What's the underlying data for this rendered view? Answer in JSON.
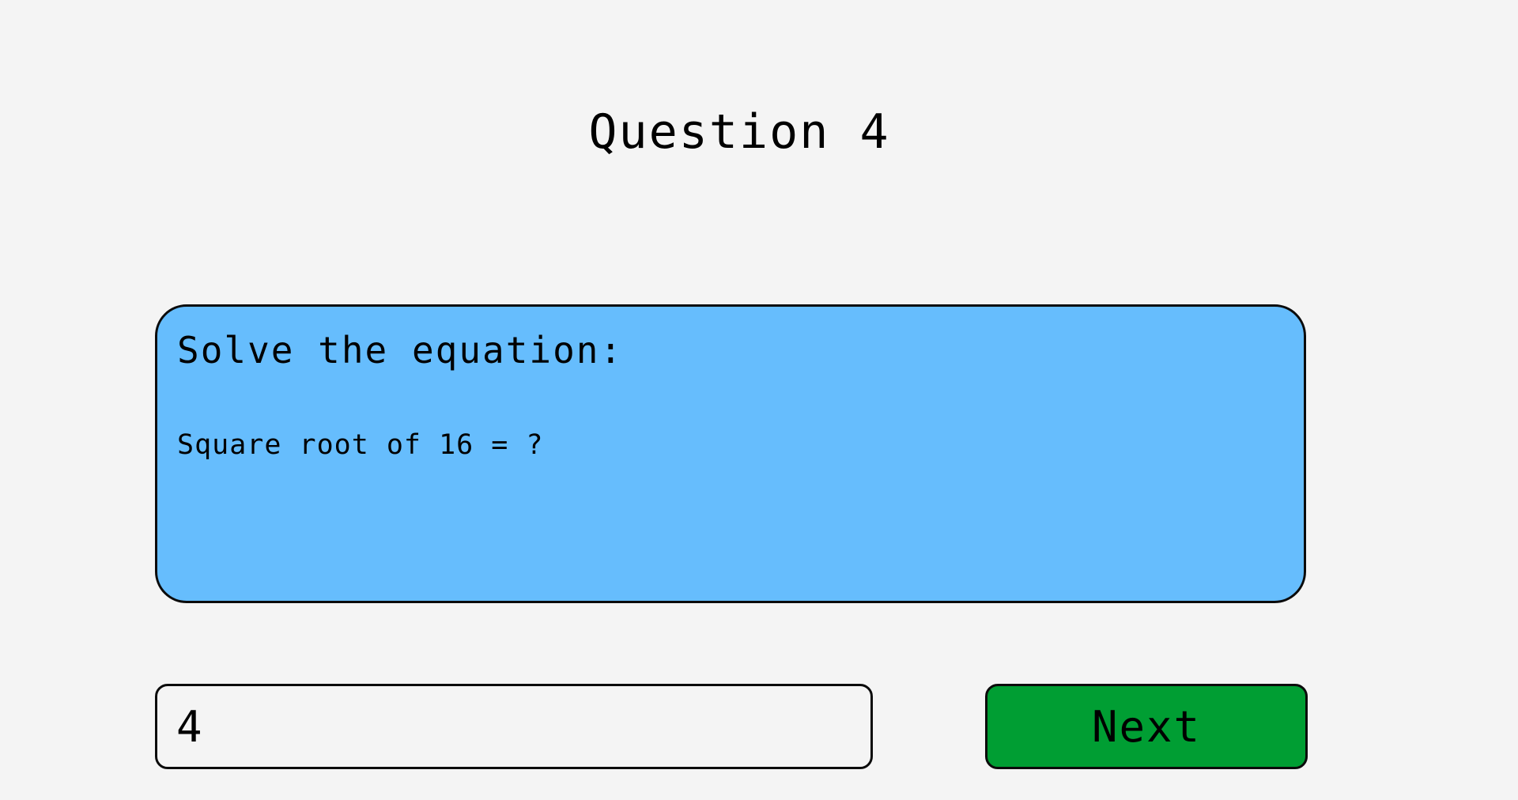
{
  "header": {
    "title": "Question 4"
  },
  "question": {
    "heading": "Solve the equation:",
    "text": "Square root of 16 = ?"
  },
  "answer": {
    "value": "4",
    "placeholder": ""
  },
  "actions": {
    "next_label": "Next"
  },
  "colors": {
    "background": "#f4f4f4",
    "panel": "#66bdfd",
    "next_button": "#009e33",
    "border": "#0b0b0b"
  }
}
